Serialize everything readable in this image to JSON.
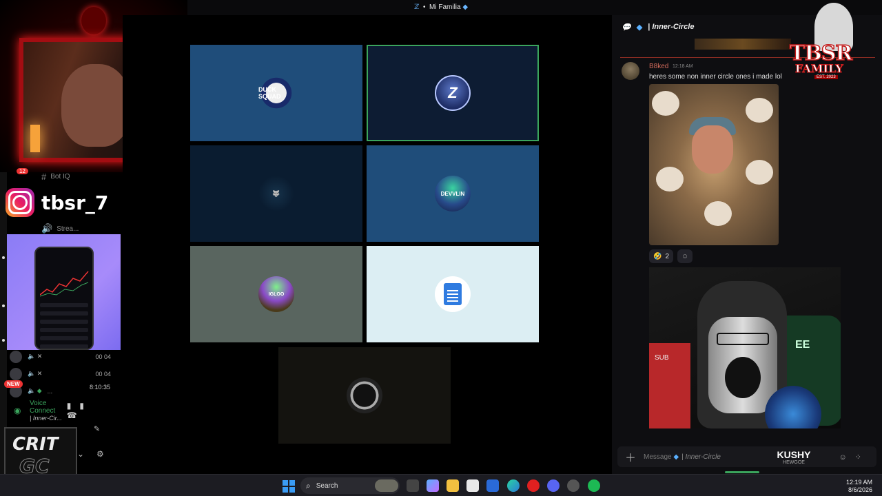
{
  "window": {
    "title": "Mi Familia",
    "nav_back": "←",
    "nav_forward": "→",
    "controls": [
      "—",
      "☐",
      "✕"
    ]
  },
  "overlay": {
    "badge_count": "12",
    "instagram_handle": "tbsr_7",
    "new_badge": "NEW",
    "crit_logo_top": "CRIT",
    "crit_logo_bottom": "GC",
    "tbsr_logo": "TBSR",
    "tbsr_family": "FAMILY",
    "tbsr_est": "EST. 2023"
  },
  "sidebar": {
    "channels": [
      {
        "icon": "#",
        "label": "Bot IQ"
      },
      {
        "icon": "🔊",
        "label": "Strea..."
      }
    ],
    "voice_members": [
      {
        "label": "",
        "count": "00 04"
      },
      {
        "label": "",
        "count": "00 04"
      },
      {
        "label": "...",
        "count": ""
      }
    ],
    "timer": "8:10:35",
    "voice_status": "Voice Connect",
    "voice_channel": "| Inner-Cir..."
  },
  "grid": {
    "tiles": [
      {
        "name": "spider-avatar",
        "label": "DUCK SQUAD"
      },
      {
        "name": "z-logo-avatar",
        "label": "Z"
      },
      {
        "name": "wolf-avatar",
        "label": "🐺"
      },
      {
        "name": "devvlin-avatar",
        "label": "DEVVLIN"
      },
      {
        "name": "igloo-avatar",
        "label": "IGLOO"
      },
      {
        "name": "doc-speaker-avatar",
        "label": ""
      },
      {
        "name": "ring-avatar",
        "label": ""
      }
    ]
  },
  "chat": {
    "channel_name": "Inner-Circle",
    "message": {
      "author": "B8ked",
      "time": "12:18 AM",
      "text": "heres some non inner circle ones i made lol"
    },
    "reaction": {
      "emoji": "🤣",
      "count": "2"
    },
    "input_placeholder": "Message",
    "input_channel": "| Inner-Circle",
    "streamer_name": "KUSHY",
    "streamer_sub": "HEWGOE",
    "cam_text_ee": "EE",
    "cam_text_sub": "SUB"
  },
  "taskbar": {
    "search_label": "Search",
    "time": "12:19 AM",
    "date": "8/6/2026"
  },
  "colors": {
    "accent_green": "#3ba55d",
    "gem_blue": "#5ab0ff",
    "frame_red": "#a30d12"
  }
}
